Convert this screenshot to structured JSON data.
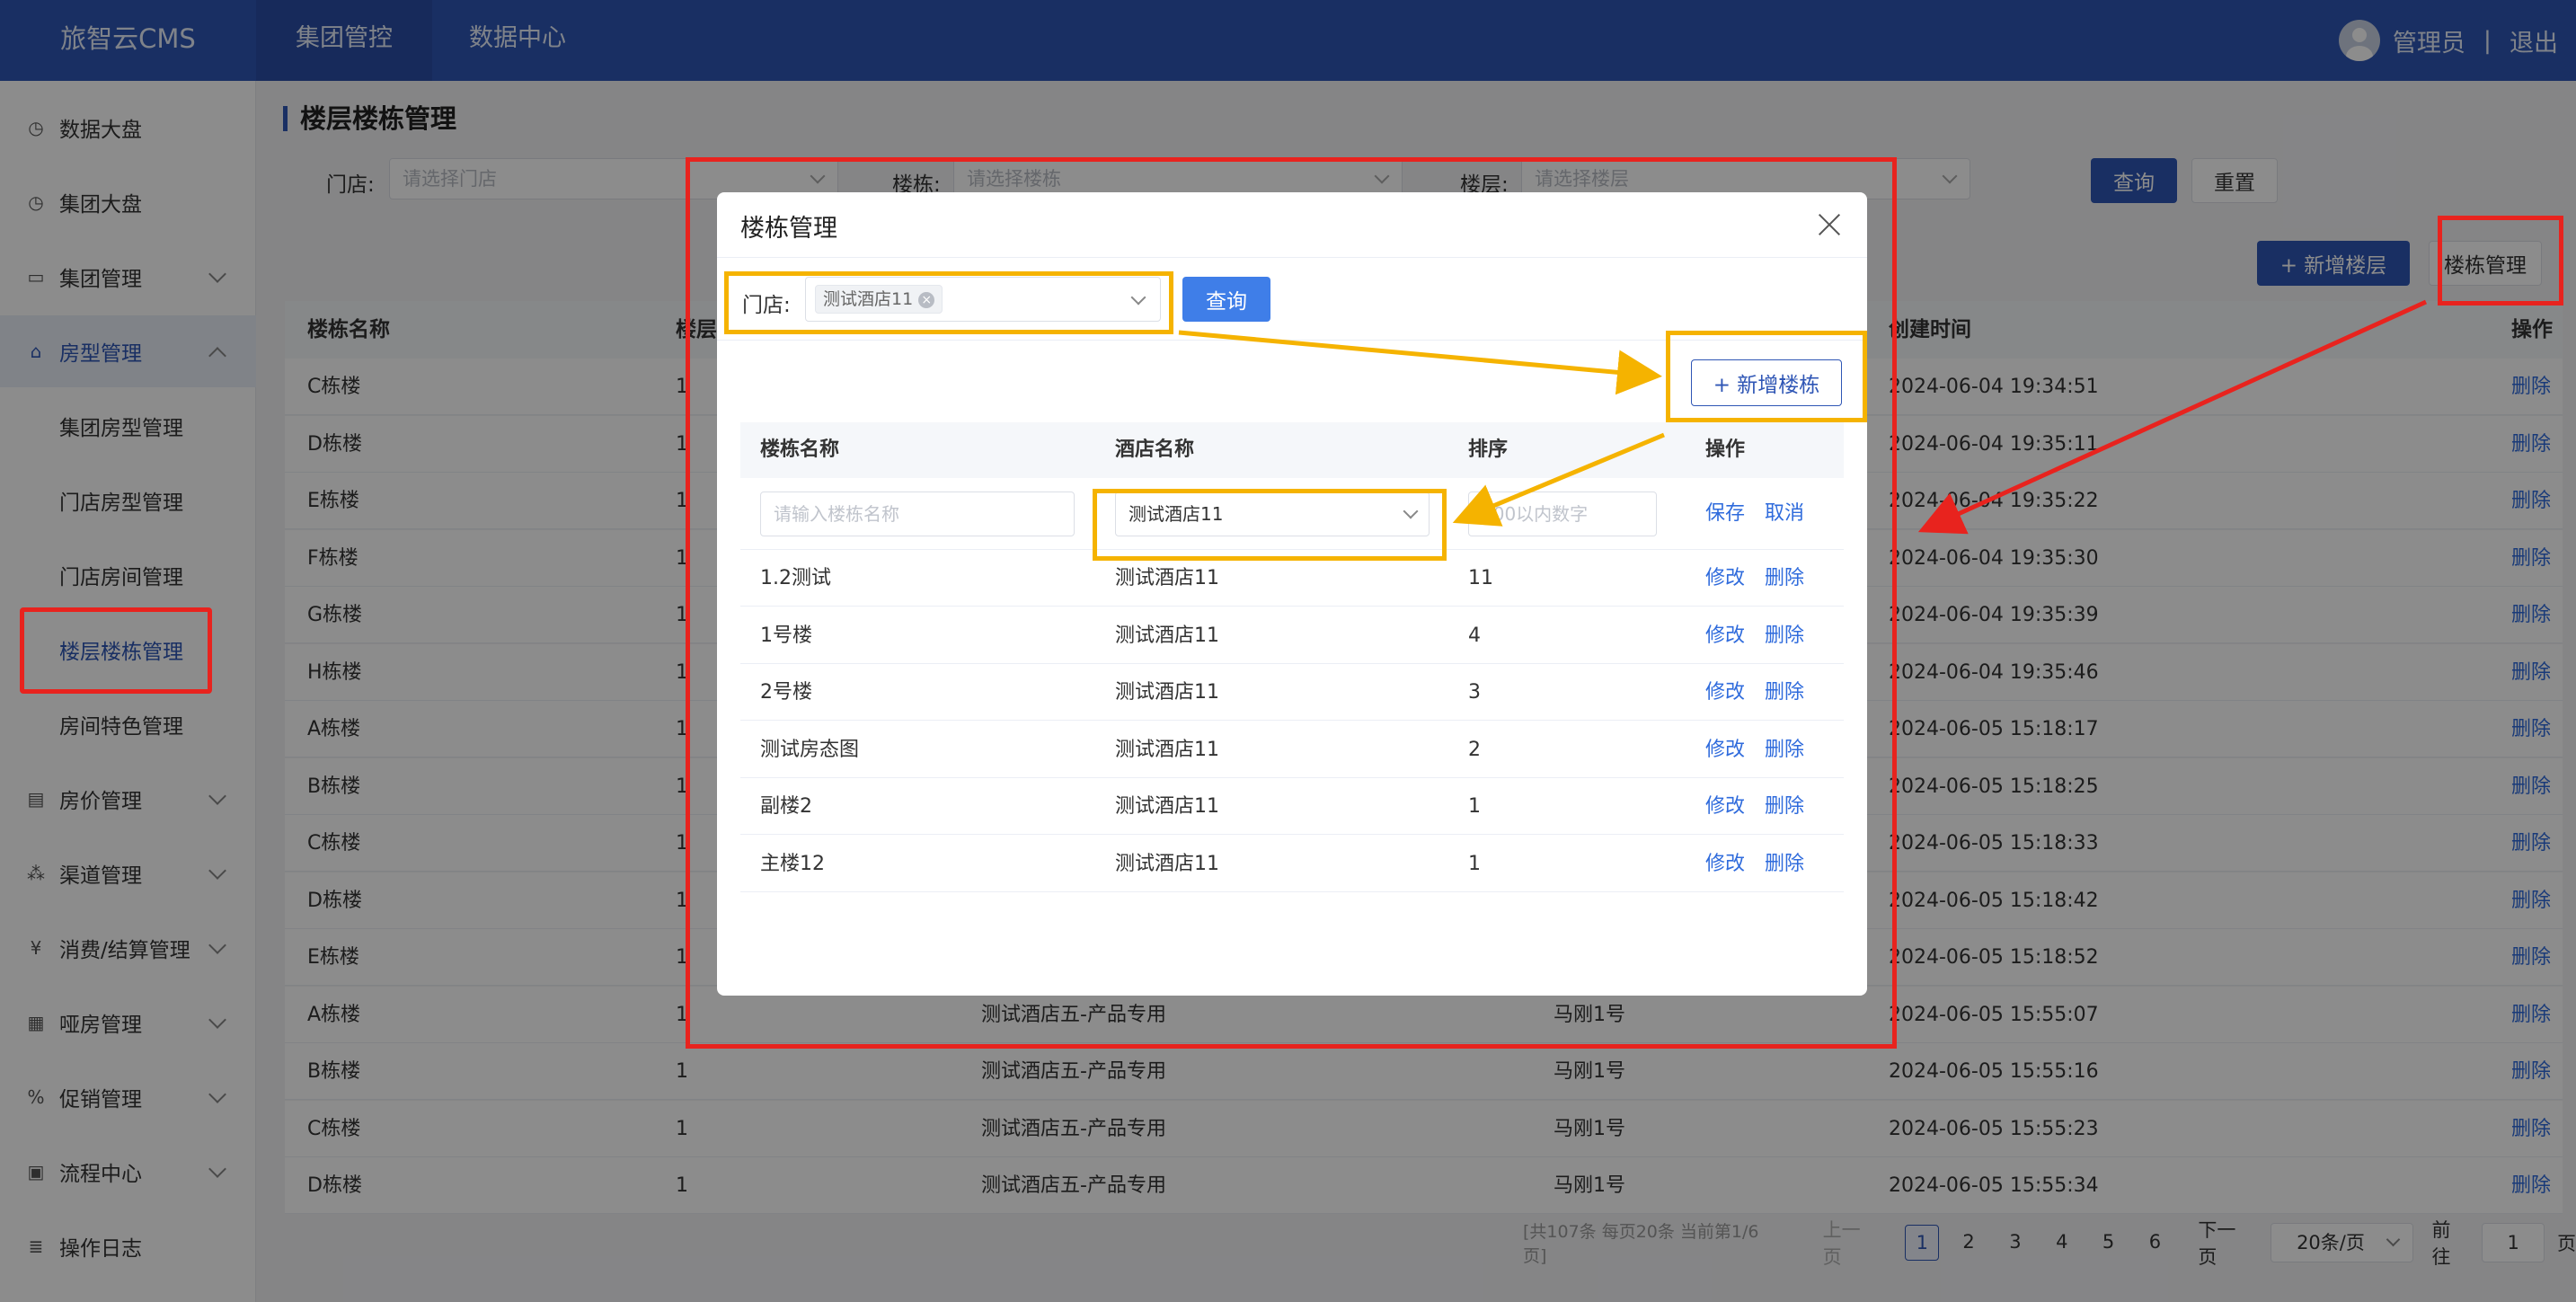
{
  "app": {
    "logo": "旅智云CMS",
    "nav": [
      "集团管控",
      "数据中心"
    ],
    "user": "管理员",
    "sep": "|",
    "logout": "退出"
  },
  "sidebar": {
    "items": [
      {
        "label": "数据大盘",
        "icon": "clock-icon"
      },
      {
        "label": "集团大盘",
        "icon": "clock-icon"
      },
      {
        "label": "集团管理",
        "icon": "monitor-icon"
      },
      {
        "label": "房型管理",
        "icon": "home-icon"
      },
      {
        "label": "房价管理",
        "icon": "wallet-icon"
      },
      {
        "label": "渠道管理",
        "icon": "network-icon"
      },
      {
        "label": "消费/结算管理",
        "icon": "yen-icon"
      },
      {
        "label": "哑房管理",
        "icon": "document-icon"
      },
      {
        "label": "促销管理",
        "icon": "discount-icon"
      },
      {
        "label": "流程中心",
        "icon": "clipboard-icon"
      },
      {
        "label": "操作日志",
        "icon": "log-icon"
      }
    ],
    "sub": [
      "集团房型管理",
      "门店房型管理",
      "门店房间管理",
      "楼层楼栋管理",
      "房间特色管理"
    ]
  },
  "page": {
    "title": "楼层楼栋管理",
    "filters": {
      "store_label": "门店:",
      "store_placeholder": "请选择门店",
      "building_label": "楼栋:",
      "building_placeholder": "请选择楼栋",
      "floor_label": "楼层:",
      "floor_placeholder": "请选择楼层"
    },
    "query": "查询",
    "reset": "重置",
    "add_floor": "+ 新增楼层",
    "building_mgmt": "楼栋管理"
  },
  "table": {
    "columns": [
      "楼栋名称",
      "楼层",
      "创建时间",
      "操作"
    ],
    "rows": [
      {
        "name": "C栋楼",
        "floor": "1",
        "hotel": "",
        "creator": "",
        "time": "2024-06-04 19:34:51"
      },
      {
        "name": "D栋楼",
        "floor": "1",
        "hotel": "",
        "creator": "",
        "time": "2024-06-04 19:35:11"
      },
      {
        "name": "E栋楼",
        "floor": "1",
        "hotel": "",
        "creator": "",
        "time": "2024-06-04 19:35:22"
      },
      {
        "name": "F栋楼",
        "floor": "1",
        "hotel": "",
        "creator": "",
        "time": "2024-06-04 19:35:30"
      },
      {
        "name": "G栋楼",
        "floor": "1",
        "hotel": "",
        "creator": "",
        "time": "2024-06-04 19:35:39"
      },
      {
        "name": "H栋楼",
        "floor": "1",
        "hotel": "",
        "creator": "",
        "time": "2024-06-04 19:35:46"
      },
      {
        "name": "A栋楼",
        "floor": "1",
        "hotel": "",
        "creator": "",
        "time": "2024-06-05 15:18:17"
      },
      {
        "name": "B栋楼",
        "floor": "1",
        "hotel": "",
        "creator": "",
        "time": "2024-06-05 15:18:25"
      },
      {
        "name": "C栋楼",
        "floor": "1",
        "hotel": "",
        "creator": "",
        "time": "2024-06-05 15:18:33"
      },
      {
        "name": "D栋楼",
        "floor": "1",
        "hotel": "",
        "creator": "",
        "time": "2024-06-05 15:18:42"
      },
      {
        "name": "E栋楼",
        "floor": "1",
        "hotel": "",
        "creator": "",
        "time": "2024-06-05 15:18:52"
      },
      {
        "name": "A栋楼",
        "floor": "1",
        "hotel": "测试酒店五-产品专用",
        "creator": "马刚1号",
        "time": "2024-06-05 15:55:07"
      },
      {
        "name": "B栋楼",
        "floor": "1",
        "hotel": "测试酒店五-产品专用",
        "creator": "马刚1号",
        "time": "2024-06-05 15:55:16"
      },
      {
        "name": "C栋楼",
        "floor": "1",
        "hotel": "测试酒店五-产品专用",
        "creator": "马刚1号",
        "time": "2024-06-05 15:55:23"
      },
      {
        "name": "D栋楼",
        "floor": "1",
        "hotel": "测试酒店五-产品专用",
        "creator": "马刚1号",
        "time": "2024-06-05 15:55:34"
      }
    ],
    "action": "删除"
  },
  "pagination": {
    "summary": "[共107条 每页20条 当前第1/6页]",
    "prev": "上一页",
    "pages": [
      "1",
      "2",
      "3",
      "4",
      "5",
      "6"
    ],
    "next": "下一页",
    "size": "20条/页",
    "goto": "前往",
    "goto_value": "1",
    "page_unit": "页"
  },
  "modal": {
    "title": "楼栋管理",
    "store_label": "门店:",
    "store_tag": "测试酒店11",
    "query": "查询",
    "add_building": "+ 新增楼栋",
    "columns": [
      "楼栋名称",
      "酒店名称",
      "排序",
      "操作"
    ],
    "new_row": {
      "name_placeholder": "请输入楼栋名称",
      "hotel": "测试酒店11",
      "sort_placeholder": "100以内数字",
      "save": "保存",
      "cancel": "取消"
    },
    "rows": [
      {
        "name": "1.2测试",
        "hotel": "测试酒店11",
        "sort": "11"
      },
      {
        "name": "1号楼",
        "hotel": "测试酒店11",
        "sort": "4"
      },
      {
        "name": "2号楼",
        "hotel": "测试酒店11",
        "sort": "3"
      },
      {
        "name": "测试房态图",
        "hotel": "测试酒店11",
        "sort": "2"
      },
      {
        "name": "副楼2",
        "hotel": "测试酒店11",
        "sort": "1"
      },
      {
        "name": "主楼12",
        "hotel": "测试酒店11",
        "sort": "1"
      }
    ],
    "edit": "修改",
    "delete": "删除"
  },
  "colors": {
    "primary": "#2f56b5",
    "link": "#2f6bdc",
    "annotation_red": "#e8231e",
    "annotation_yellow": "#f5b300"
  }
}
